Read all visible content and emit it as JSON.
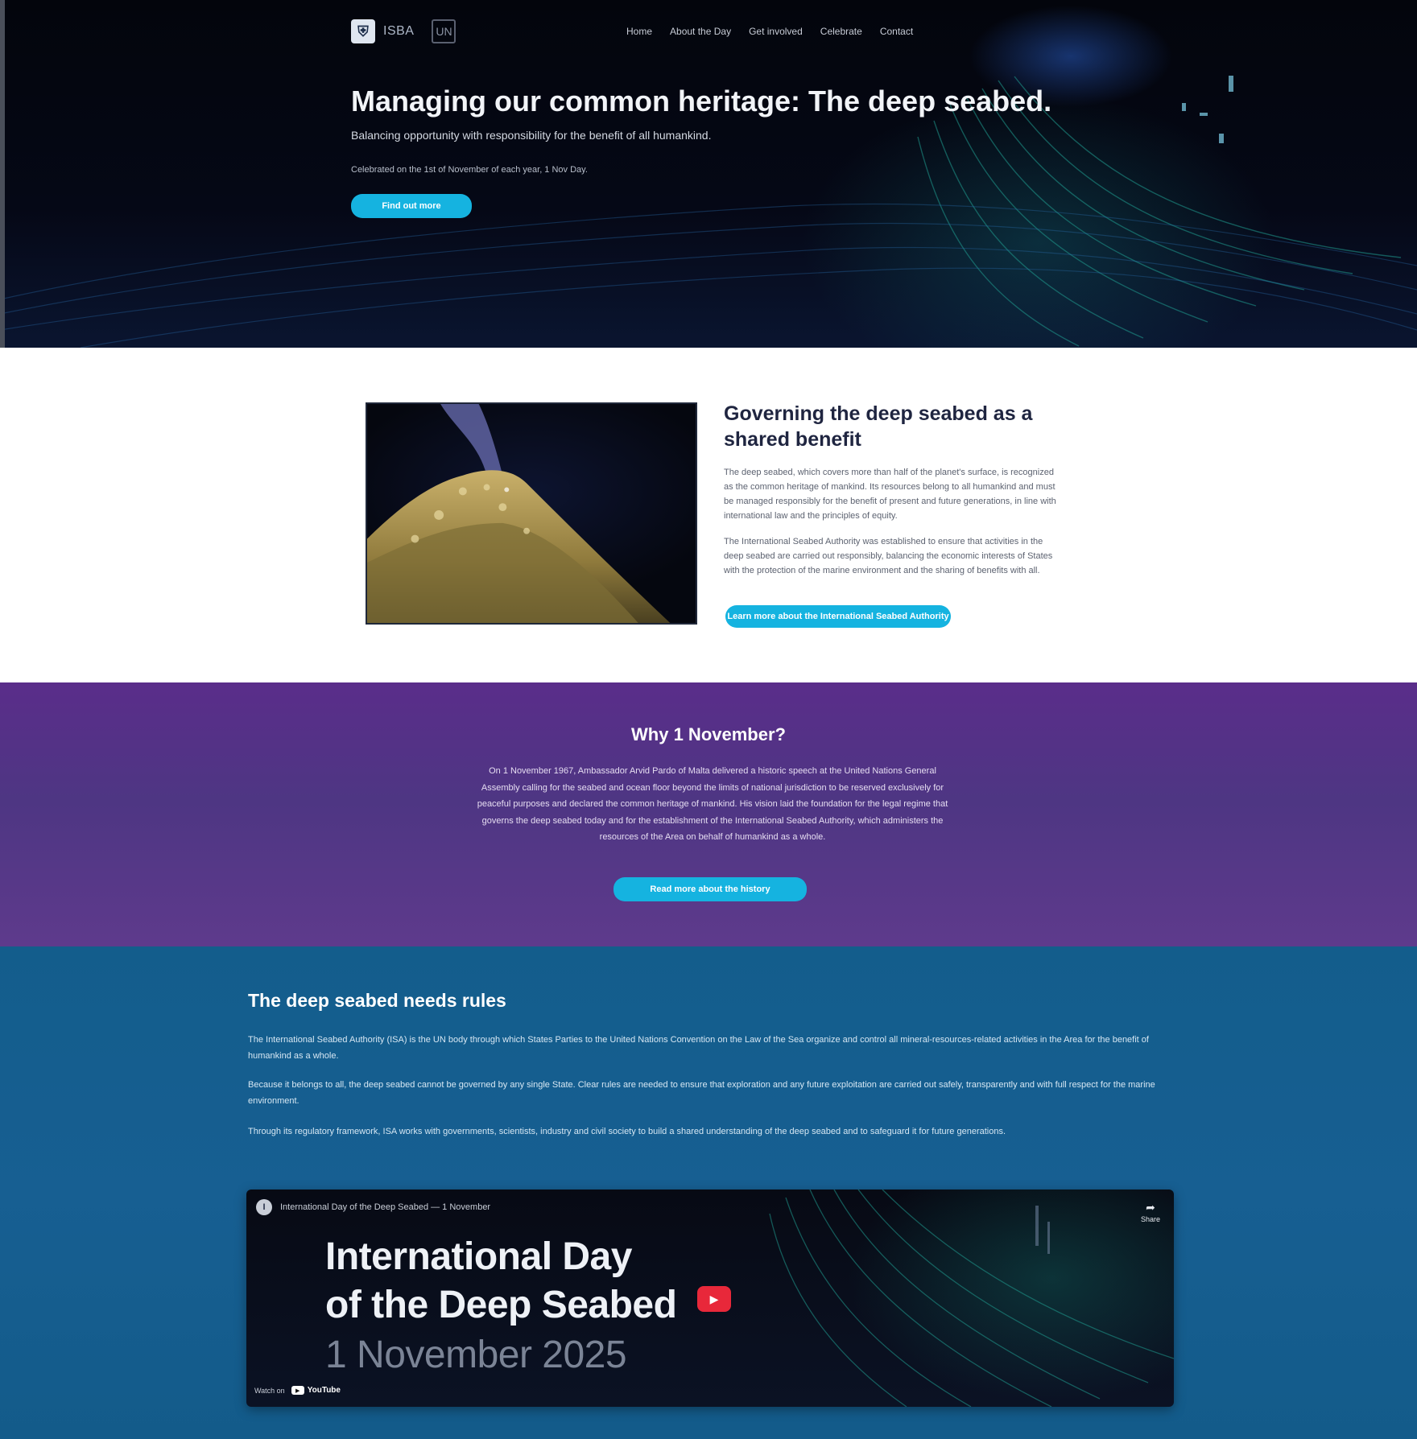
{
  "hero": {
    "logo_text": "ISBA",
    "logo_badge": "UN",
    "nav": [
      "Home",
      "About the Day",
      "Get involved",
      "Celebrate",
      "Contact"
    ],
    "title": "Managing our common heritage: The deep seabed.",
    "subtitle": "Balancing opportunity with responsibility for the benefit of all humankind.",
    "note": "Celebrated on the 1st of November of each year, 1 Nov Day.",
    "cta": "Find out more"
  },
  "governing": {
    "title": "Governing the deep seabed as a shared benefit",
    "p1": "The deep seabed, which covers more than half of the planet's surface, is recognized as the common heritage of mankind. Its resources belong to all humankind and must be managed responsibly for the benefit of present and future generations, in line with international law and the principles of equity.",
    "p2": "The International Seabed Authority was established to ensure that activities in the deep seabed are carried out responsibly, balancing the economic interests of States with the protection of the marine environment and the sharing of benefits with all.",
    "cta": "Learn more about the International Seabed Authority"
  },
  "why": {
    "title": "Why 1 November?",
    "text": "On 1 November 1967, Ambassador Arvid Pardo of Malta delivered a historic speech at the United Nations General Assembly calling for the seabed and ocean floor beyond the limits of national jurisdiction to be reserved exclusively for peaceful purposes and declared the common heritage of mankind. His vision laid the foundation for the legal regime that governs the deep seabed today and for the establishment of the International Seabed Authority, which administers the resources of the Area on behalf of humankind as a whole.",
    "cta": "Read more about the history"
  },
  "rules": {
    "title": "The deep seabed needs rules",
    "p1": "The International Seabed Authority (ISA) is the UN body through which States Parties to the United Nations Convention on the Law of the Sea organize and control all mineral-resources-related activities in the Area for the benefit of humankind as a whole.",
    "p2": "Because it belongs to all, the deep seabed cannot be governed by any single State. Clear rules are needed to ensure that exploration and any future exploitation are carried out safely, transparently and with full respect for the marine environment.",
    "p3": "Through its regulatory framework, ISA works with governments, scientists, industry and civil society to build a shared understanding of the deep seabed and to safeguard it for future generations."
  },
  "video": {
    "caption": "International Day of the Deep Seabed — 1 November",
    "channel_initial": "I",
    "share_label": "Share",
    "line1": "International Day",
    "line2": "of the Deep Seabed",
    "line3": "1 November 2025",
    "watch_on": "Watch on",
    "yt_label": "YouTube"
  },
  "colors": {
    "accent": "#15b3e0",
    "purple": "#4e3683",
    "blue": "#175f92",
    "play": "#e8283a"
  },
  "icons": {
    "logo": "shield-logo-icon",
    "play": "play-icon",
    "share": "share-icon",
    "youtube": "youtube-icon"
  }
}
